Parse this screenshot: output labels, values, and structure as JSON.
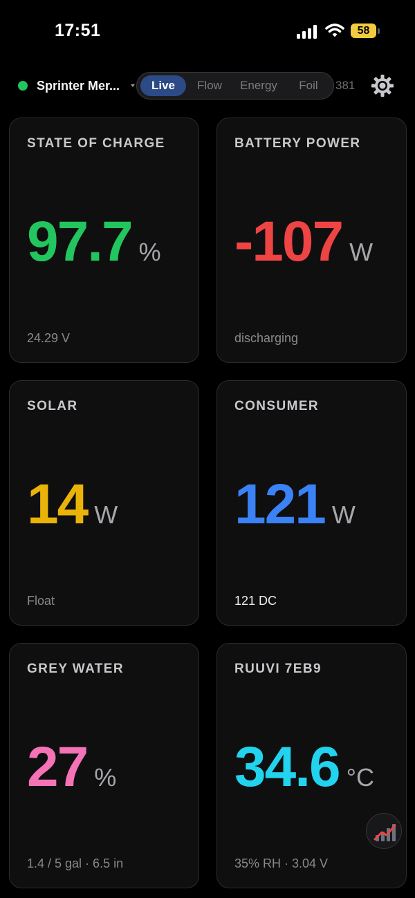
{
  "status_bar": {
    "time": "17:51",
    "battery_level": "58",
    "icons": [
      "signal-icon",
      "wifi-icon",
      "battery-icon"
    ]
  },
  "header": {
    "device_name": "Sprinter Mer...",
    "status_color": "#22c55e",
    "tabs": [
      {
        "label": "Live",
        "active": true
      },
      {
        "label": "Flow",
        "active": false
      },
      {
        "label": "Energy",
        "active": false
      },
      {
        "label": "Foil",
        "active": false
      }
    ],
    "count": "381",
    "settings_icon": "gear-icon"
  },
  "cards": [
    {
      "title": "STATE OF CHARGE",
      "value": "97.7",
      "unit": "%",
      "sub": "24.29 V",
      "color": "#22c55e"
    },
    {
      "title": "BATTERY POWER",
      "value": "-107",
      "unit": "W",
      "sub": "discharging",
      "color": "#ef4444"
    },
    {
      "title": "SOLAR",
      "value": "14",
      "unit": "W",
      "sub": "Float",
      "color": "#eab308"
    },
    {
      "title": "CONSUMER",
      "value": "121",
      "unit": "W",
      "sub": "121 DC",
      "color": "#3b82f6"
    },
    {
      "title": "GREY WATER",
      "value": "27",
      "unit": "%",
      "sub": "1.4 / 5 gal · 6.5 in",
      "color": "#f472b6"
    },
    {
      "title": "RUUVI 7EB9",
      "value": "34.6",
      "unit": "°C",
      "sub": "35% RH · 3.04 V",
      "color": "#22d3ee"
    }
  ],
  "fab": {
    "icon": "chart-icon"
  }
}
